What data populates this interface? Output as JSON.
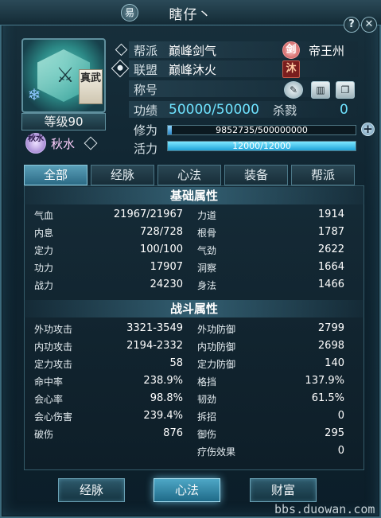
{
  "window": {
    "title": "瞎仔丶",
    "emblem_glyph": "易",
    "help_glyph": "?",
    "close_glyph": "✕"
  },
  "portrait": {
    "badge": "真武",
    "level": "等级90",
    "school_icon_text": "秋水",
    "school_name": "秋水"
  },
  "info": {
    "guild_label": "帮派",
    "guild_value": "巅峰剑气",
    "guild_icon": "剑",
    "city": "帝王州",
    "alliance_label": "联盟",
    "alliance_value": "巅峰沐火",
    "alliance_icon": "沐",
    "title_label": "称号",
    "merit_label": "功绩",
    "merit_value": "50000/50000",
    "kills_label": "杀戮",
    "kills_value": "0",
    "cultivation_label": "修为",
    "cultivation_text": "9852735/500000000",
    "cultivation_fraction": 0.0197,
    "vitality_label": "活力",
    "vitality_text": "12000/12000",
    "vitality_fraction": 1.0
  },
  "tabs": [
    "全部",
    "经脉",
    "心法",
    "装备",
    "帮派"
  ],
  "active_tab": 0,
  "sections": {
    "basic": "基础属性",
    "combat": "战斗属性"
  },
  "basic_stats": [
    {
      "label": "气血",
      "value": "21967/21967",
      "label2": "力道",
      "value2": "1914"
    },
    {
      "label": "内息",
      "value": "728/728",
      "label2": "根骨",
      "value2": "1787"
    },
    {
      "label": "定力",
      "value": "100/100",
      "label2": "气劲",
      "value2": "2622"
    },
    {
      "label": "功力",
      "value": "17907",
      "label2": "洞察",
      "value2": "1664"
    },
    {
      "label": "战力",
      "value": "24230",
      "label2": "身法",
      "value2": "1466"
    }
  ],
  "combat_stats": [
    {
      "label": "外功攻击",
      "value": "3321-3549",
      "label2": "外功防御",
      "value2": "2799"
    },
    {
      "label": "内功攻击",
      "value": "2194-2332",
      "label2": "内功防御",
      "value2": "2698"
    },
    {
      "label": "定力攻击",
      "value": "58",
      "label2": "定力防御",
      "value2": "140"
    },
    {
      "label": "命中率",
      "value": "238.9%",
      "label2": "格挡",
      "value2": "137.9%"
    },
    {
      "label": "会心率",
      "value": "98.8%",
      "label2": "韧劲",
      "value2": "61.5%"
    },
    {
      "label": "会心伤害",
      "value": "239.4%",
      "label2": "拆招",
      "value2": "0"
    },
    {
      "label": "破伤",
      "value": "876",
      "label2": "御伤",
      "value2": "295"
    },
    {
      "label": "",
      "value": "",
      "label2": "疗伤效果",
      "value2": "0"
    }
  ],
  "bottom_buttons": [
    "经脉",
    "心法",
    "财富"
  ],
  "active_bottom": 1,
  "watermark": "bbs.duowan.com",
  "colors": {
    "accent": "#6fe3ff",
    "active_tab": "#4a93ad",
    "panel": "#0f2430"
  }
}
